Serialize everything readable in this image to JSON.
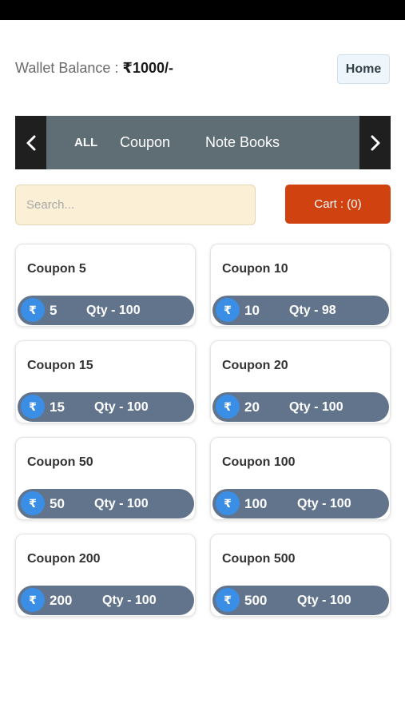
{
  "wallet": {
    "label": "Wallet Balance :",
    "amount": "₹1000/-"
  },
  "header": {
    "home_label": "Home"
  },
  "categories": {
    "tabs": [
      {
        "label": "ALL"
      },
      {
        "label": "Coupon"
      },
      {
        "label": "Note Books"
      }
    ]
  },
  "search": {
    "placeholder": "Search...",
    "value": ""
  },
  "cart": {
    "label": "Cart : (0)"
  },
  "currency_symbol": "₹",
  "colors": {
    "cart_button": "#d0420f",
    "card_pill": "#62748b",
    "rupee_badge": "#3a8ee6",
    "category_bar": "#5f6e74",
    "search_bg": "#fbf0d6"
  },
  "products": [
    {
      "title": "Coupon 5",
      "price": "5",
      "qty": "Qty - 100"
    },
    {
      "title": "Coupon 10",
      "price": "10",
      "qty": "Qty - 98"
    },
    {
      "title": "Coupon 15",
      "price": "15",
      "qty": "Qty - 100"
    },
    {
      "title": "Coupon 20",
      "price": "20",
      "qty": "Qty - 100"
    },
    {
      "title": "Coupon 50",
      "price": "50",
      "qty": "Qty - 100"
    },
    {
      "title": "Coupon 100",
      "price": "100",
      "qty": "Qty - 100"
    },
    {
      "title": "Coupon 200",
      "price": "200",
      "qty": "Qty - 100"
    },
    {
      "title": "Coupon 500",
      "price": "500",
      "qty": "Qty - 100"
    }
  ]
}
